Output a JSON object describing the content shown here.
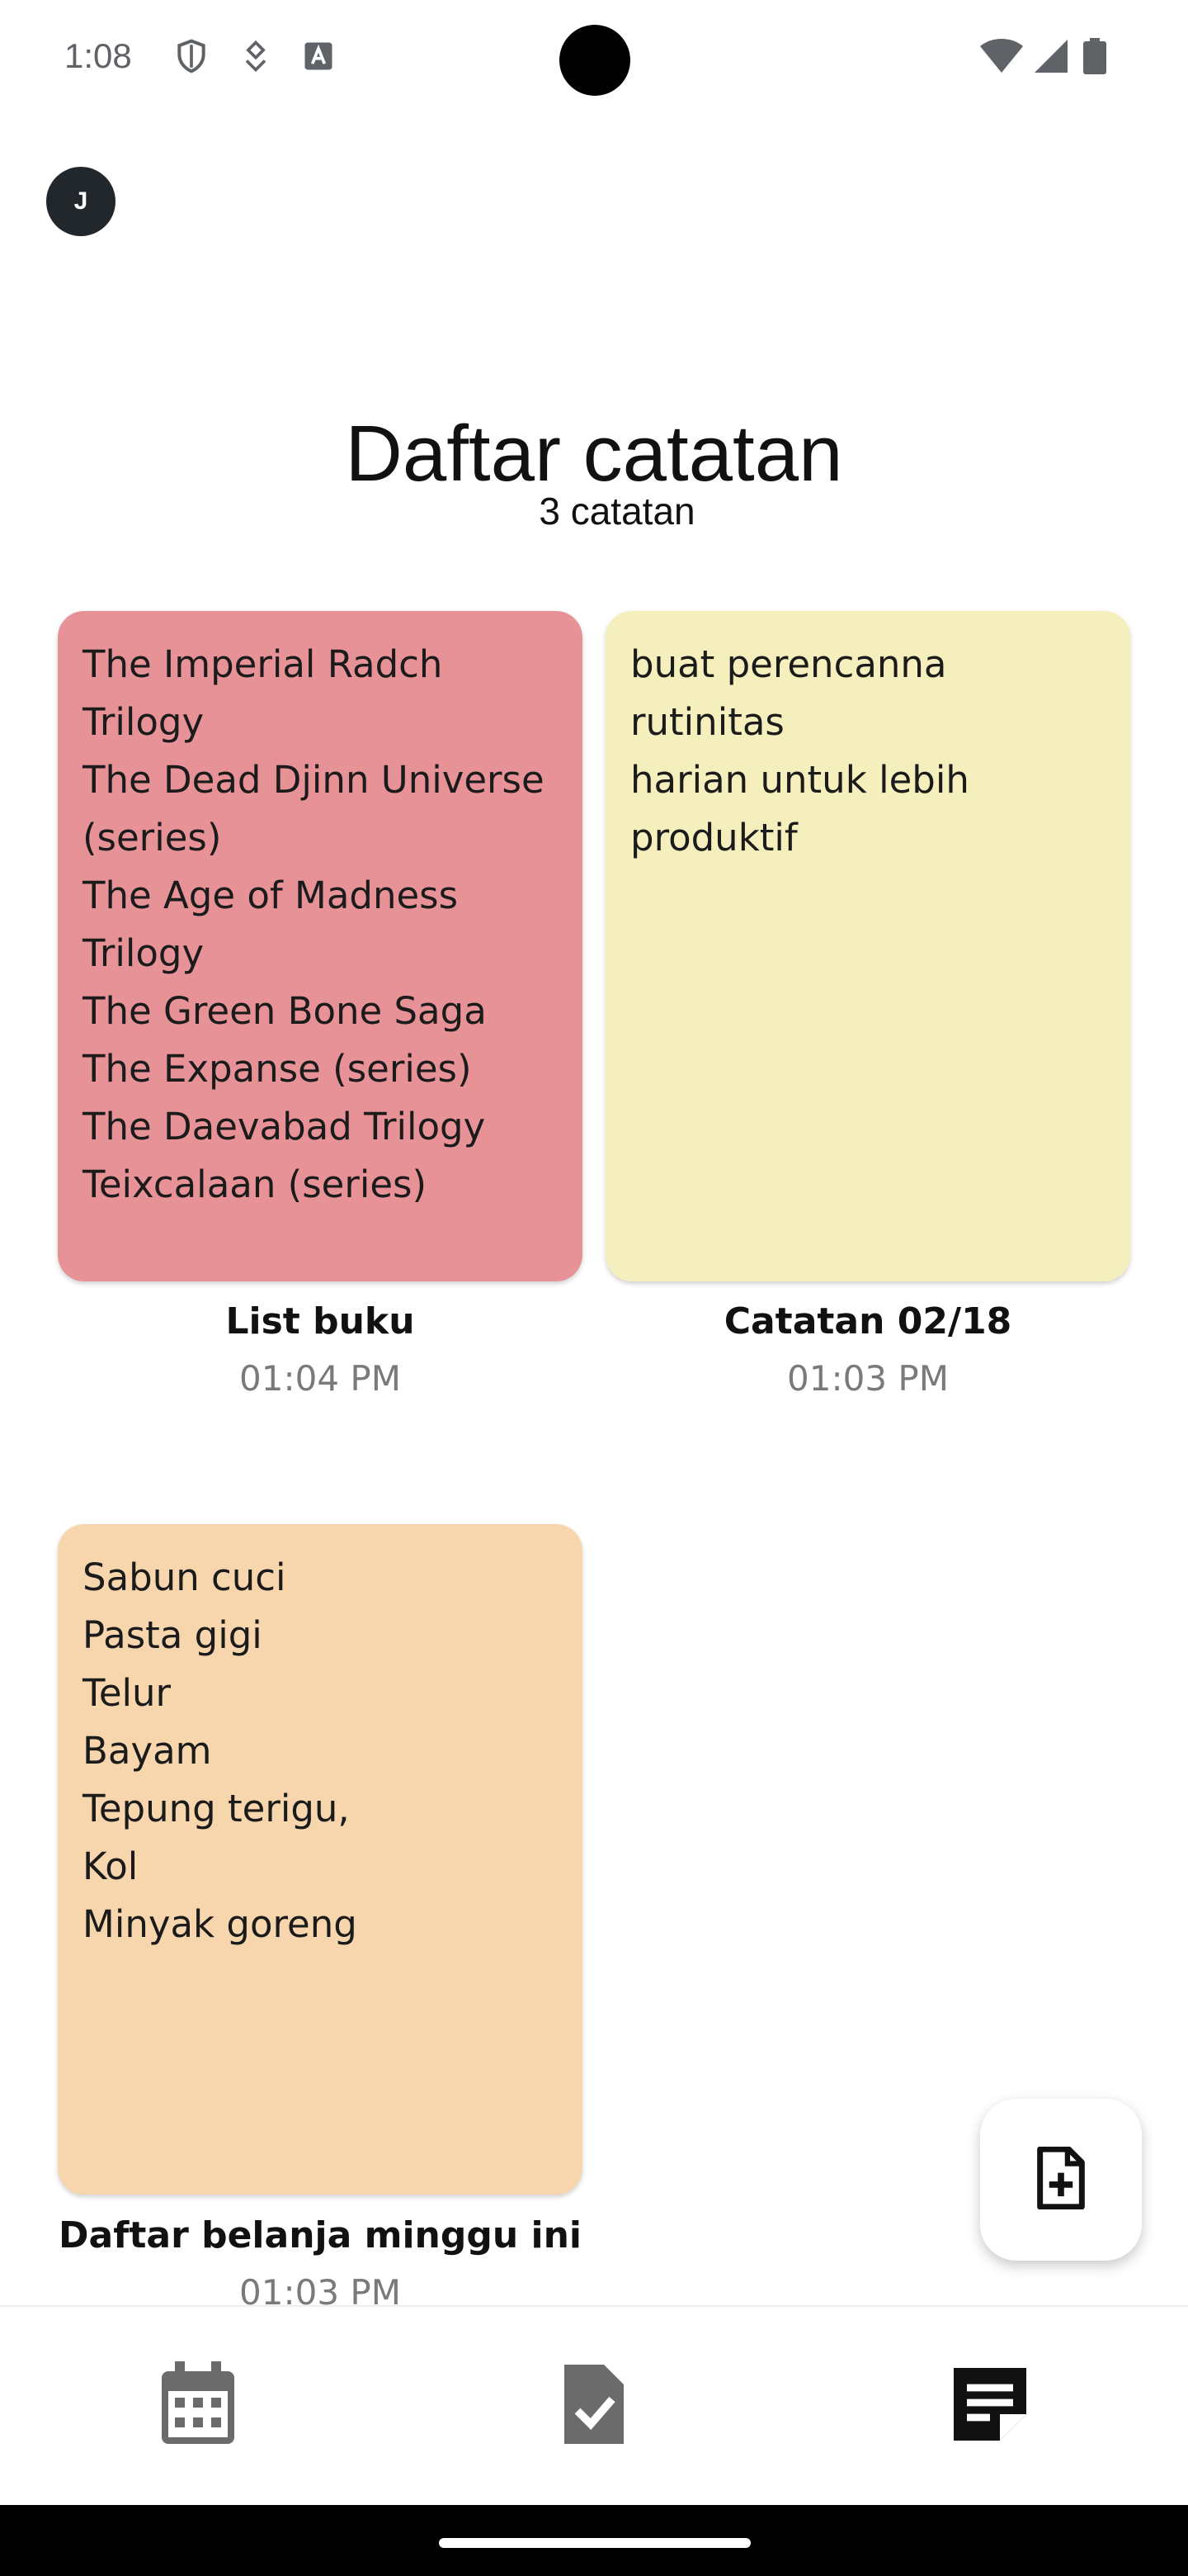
{
  "status_bar": {
    "time": "1:08",
    "icons": [
      "shield-icon",
      "vpn-key-icon",
      "font-a-icon",
      "wifi-icon",
      "cellular-signal-icon",
      "battery-icon"
    ]
  },
  "avatar": {
    "initial": "J"
  },
  "header": {
    "title": "Daftar catatan",
    "count": "3 catatan"
  },
  "notes": [
    {
      "body": "The Imperial Radch\nTrilogy\nThe Dead Djinn Universe\n(series)\nThe Age of Madness\nTrilogy\nThe Green Bone Saga\nThe Expanse (series)\nThe Daevabad Trilogy\nTeixcalaan (series)",
      "title": "List buku",
      "time": "01:04 PM",
      "color": "#e69296"
    },
    {
      "body": "buat perencanna rutinitas\nharian untuk lebih\nproduktif",
      "title": "Catatan 02/18",
      "time": "01:03 PM",
      "color": "#f5eebd"
    },
    {
      "body": "Sabun cuci\nPasta gigi\nTelur\nBayam\nTepung terigu,\nKol\nMinyak goreng",
      "title": "Daftar belanja minggu ini",
      "time": "01:03 PM",
      "color": "#f7d5ad"
    }
  ],
  "fab": {
    "icon": "add-note-icon"
  },
  "bottom_nav": {
    "items": [
      {
        "icon": "calendar-icon",
        "active": false
      },
      {
        "icon": "task-check-icon",
        "active": false
      },
      {
        "icon": "notes-icon",
        "active": true
      }
    ]
  }
}
